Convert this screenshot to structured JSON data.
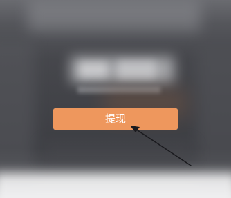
{
  "withdraw_button": {
    "label": "提现"
  },
  "colors": {
    "button_bg": "#ee975d",
    "button_text": "#ffffff",
    "overlay": "#414247",
    "arrow": "#1a1a1e"
  }
}
